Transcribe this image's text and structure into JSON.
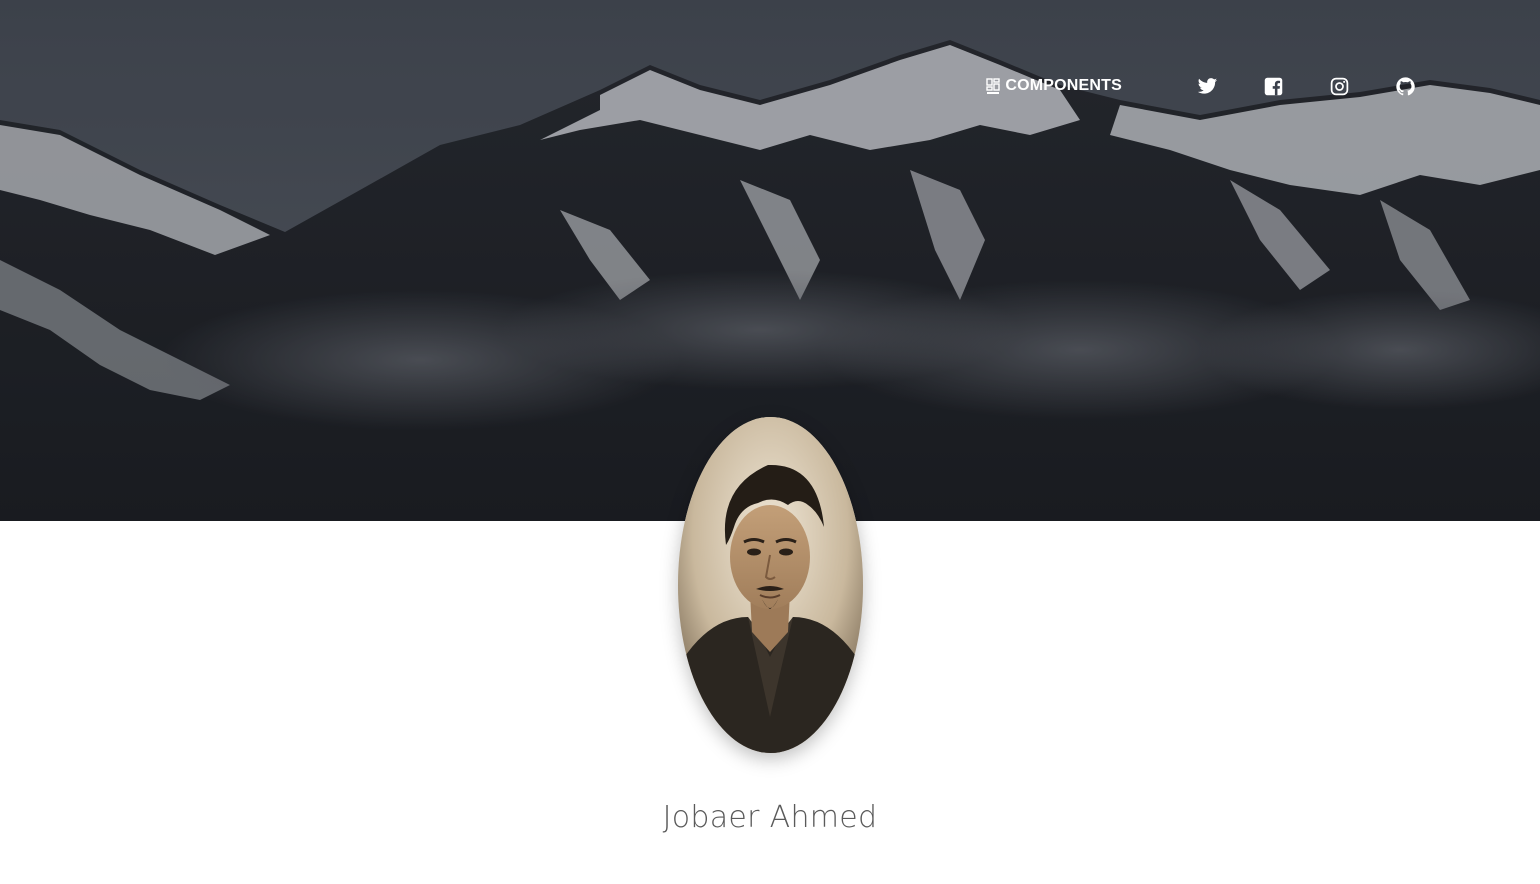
{
  "navbar": {
    "components_label": "COMPONENTS",
    "components_icon": "dashboard-icon",
    "social": [
      {
        "name": "twitter",
        "icon": "twitter-icon"
      },
      {
        "name": "facebook",
        "icon": "facebook-icon"
      },
      {
        "name": "instagram",
        "icon": "instagram-icon"
      },
      {
        "name": "github",
        "icon": "github-icon"
      }
    ]
  },
  "profile": {
    "name": "Jobaer Ahmed"
  },
  "colors": {
    "hero_overlay": "#3b404b",
    "nav_text": "#ffffff",
    "name_text": "#5a5a5a"
  }
}
